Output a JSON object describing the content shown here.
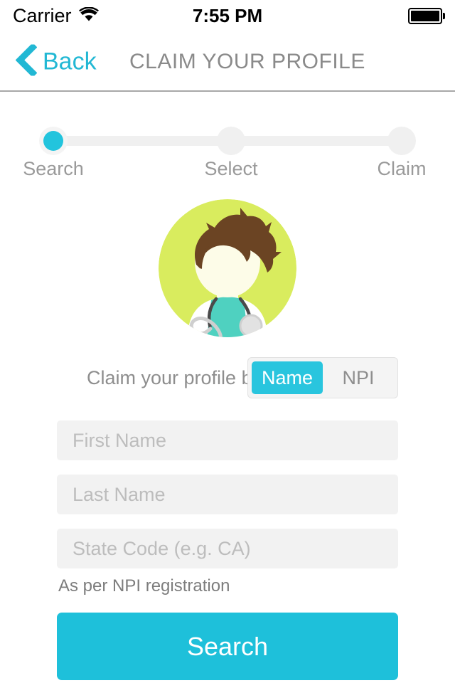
{
  "status_bar": {
    "carrier": "Carrier",
    "wifi_icon": "wifi-icon",
    "time": "7:55 PM",
    "battery_icon": "battery-full-icon"
  },
  "nav": {
    "back_icon": "chevron-left-icon",
    "back_label": "Back",
    "title": "CLAIM YOUR PROFILE"
  },
  "stepper": {
    "steps": [
      {
        "label": "Search",
        "active": true
      },
      {
        "label": "Select",
        "active": false
      },
      {
        "label": "Claim",
        "active": false
      }
    ]
  },
  "avatar": {
    "icon": "doctor-avatar-icon",
    "background_color": "#d9ec5e",
    "hair_color": "#6b4423",
    "face_color": "#fdfce8",
    "coat_color": "#ffffff",
    "scrubs_color": "#4fd1c0",
    "stethoscope_color": "#4a4a4a"
  },
  "form": {
    "segment_caption": "Claim your profile by",
    "segments": [
      {
        "label": "Name",
        "selected": true
      },
      {
        "label": "NPI",
        "selected": false
      }
    ],
    "fields": [
      {
        "name": "first-name",
        "placeholder": "First Name",
        "value": ""
      },
      {
        "name": "last-name",
        "placeholder": "Last Name",
        "value": ""
      },
      {
        "name": "state-code",
        "placeholder": "State Code (e.g. CA)",
        "value": ""
      }
    ],
    "helper_text": "As per NPI registration",
    "submit_label": "Search"
  },
  "colors": {
    "accent": "#1ec0da",
    "accent_light": "#29c5de",
    "field_bg": "#f2f2f2",
    "track": "#f0f0f0",
    "text_muted": "#8e8e8e"
  }
}
